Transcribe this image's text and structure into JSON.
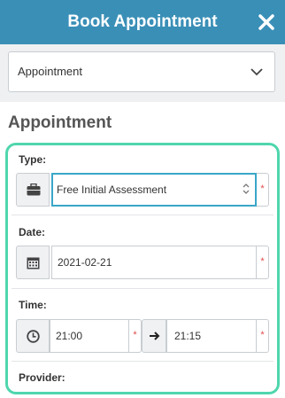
{
  "header": {
    "title": "Book Appointment",
    "close_icon": "close-icon"
  },
  "top_select": {
    "value": "Appointment",
    "icon": "chevron-down-icon"
  },
  "section": {
    "title": "Appointment"
  },
  "form": {
    "type": {
      "label": "Type:",
      "value": "Free Initial Assessment",
      "icon": "briefcase-icon",
      "required_mark": "*"
    },
    "date": {
      "label": "Date:",
      "value": "2021-02-21",
      "icon": "calendar-icon",
      "required_mark": "*"
    },
    "time": {
      "label": "Time:",
      "start": "21:00",
      "end": "21:15",
      "icon": "clock-icon",
      "arrow_icon": "arrow-right-icon",
      "required_mark": "*"
    },
    "provider": {
      "label": "Provider:"
    }
  },
  "colors": {
    "header_bg": "#3a8fb7",
    "accent_border": "#4fd6ad",
    "focus_border": "#3aa6c8",
    "required": "#e04848"
  }
}
